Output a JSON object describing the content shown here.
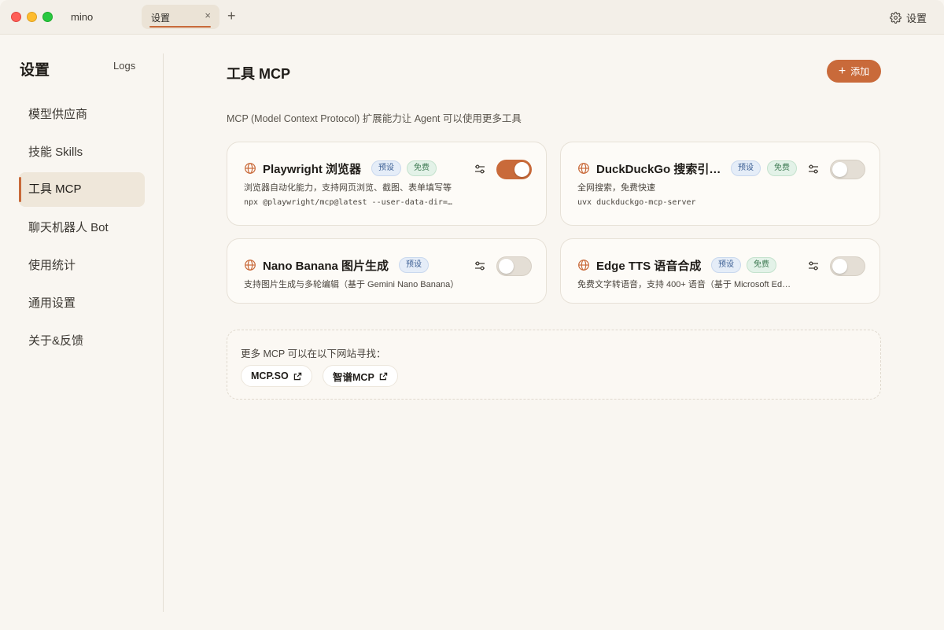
{
  "window": {
    "app_name": "mino",
    "tabs": [
      {
        "label": "设置"
      }
    ],
    "tab_close_glyph": "×",
    "tab_add_glyph": "+",
    "top_settings_label": "设置"
  },
  "sidebar": {
    "title": "设置",
    "logs_label": "Logs",
    "items": [
      {
        "label": "模型供应商"
      },
      {
        "label": "技能 Skills"
      },
      {
        "label": "工具 MCP",
        "active": true
      },
      {
        "label": "聊天机器人 Bot"
      },
      {
        "label": "使用统计"
      },
      {
        "label": "通用设置"
      },
      {
        "label": "关于&反馈"
      }
    ]
  },
  "main": {
    "title": "工具 MCP",
    "add_label": "添加",
    "description": "MCP (Model Context Protocol) 扩展能力让 Agent 可以使用更多工具",
    "cards": [
      {
        "name": "Playwright 浏览器",
        "badges": [
          "预设",
          "免费"
        ],
        "description": "浏览器自动化能力，支持网页浏览、截图、表单填写等",
        "command": "npx @playwright/mcp@latest --user-data-dir=…",
        "enabled": true
      },
      {
        "name": "DuckDuckGo 搜索引…",
        "badges": [
          "预设",
          "免费"
        ],
        "description": "全网搜索，免费快速",
        "command": "uvx duckduckgo-mcp-server",
        "enabled": false
      },
      {
        "name": "Nano Banana 图片生成",
        "badges": [
          "预设"
        ],
        "description": "支持图片生成与多轮编辑（基于 Gemini Nano Banana）",
        "enabled": false
      },
      {
        "name": "Edge TTS 语音合成",
        "badges": [
          "预设",
          "免费"
        ],
        "description": "免费文字转语音，支持 400+ 语音（基于 Microsoft Ed…",
        "enabled": false
      }
    ],
    "more": {
      "label": "更多 MCP 可以在以下网站寻找：",
      "links": [
        {
          "label": "MCP.SO"
        },
        {
          "label": "智谱MCP"
        }
      ]
    }
  },
  "colors": {
    "accent": "#c96a3a",
    "background": "#f9f6f1",
    "preset_badge": "#e5edf8",
    "free_badge": "#e3f2e8"
  },
  "icons": {
    "card": "globe-icon",
    "config": "sliders-icon",
    "settings": "gear-icon",
    "link": "external-link-icon",
    "add": "plus-icon"
  }
}
